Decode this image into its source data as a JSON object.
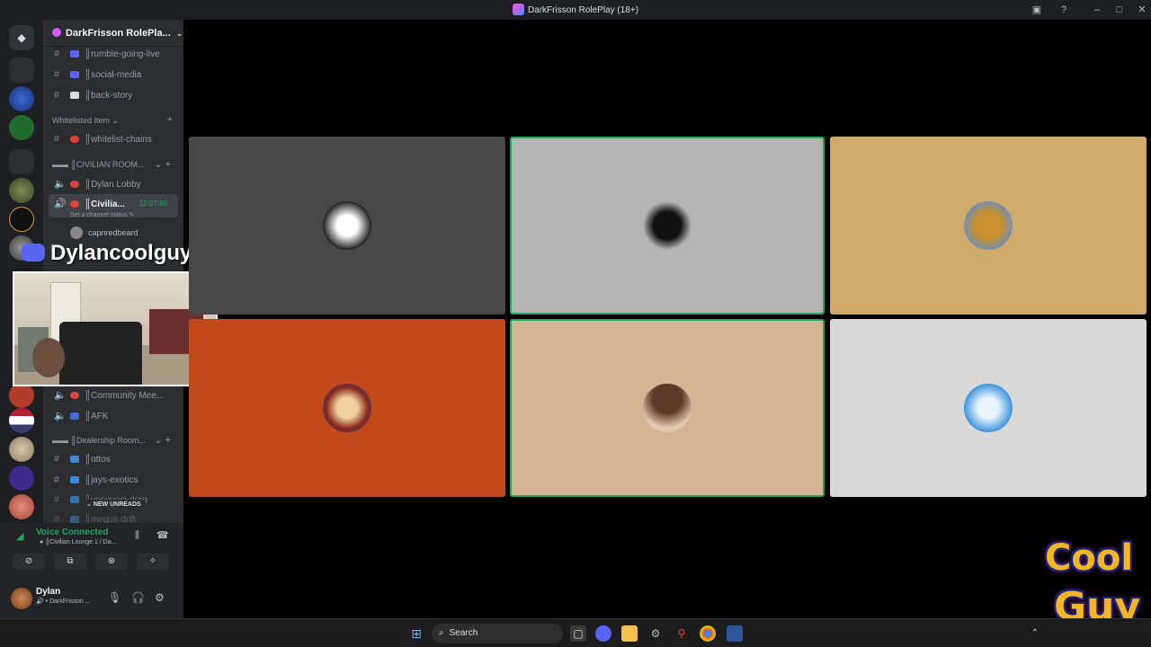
{
  "window": {
    "title": "DarkFrisson RolePlay (18+)",
    "icons": [
      "inbox-icon",
      "help-icon",
      "minimize-icon",
      "maximize-icon",
      "close-icon"
    ]
  },
  "guild": {
    "name": "DarkFrisson RolePla...",
    "channels_top": [
      {
        "label": "║rumble-going-live"
      },
      {
        "label": "║social-media"
      },
      {
        "label": "║back-story"
      }
    ],
    "category_whitelist": "Whitelisted Item",
    "whitelist_channel": "║whitelist-chains",
    "category_civilian": "║CIVILIAN ROOM...",
    "voice_dylan_lobby": "║Dylan Lobby",
    "voice_active": "║Civilia...",
    "voice_active_timer": "12:07:86",
    "voice_status_hint": "Set a channel status",
    "voice_member": "capnredbeard",
    "voice_community": "║Community Mee...",
    "voice_afk": "║AFK",
    "category_dealership": "║Dealership Room...",
    "dealer_channels": [
      {
        "label": "║ottos"
      },
      {
        "label": "║jays-exotics"
      },
      {
        "label": "║yoooyosi-drag"
      },
      {
        "label": "║megus-drift"
      }
    ],
    "new_unreads": "NEW UNREADS"
  },
  "voice_panel": {
    "status": "Voice Connected",
    "channel": "║Civilian Lounge 1 / Da..."
  },
  "user_panel": {
    "name": "Dylan",
    "sub": "DarkFrisson ..."
  },
  "overlay": {
    "streamer_name": "Dylancoolguy"
  },
  "tiles": [
    {
      "bg": "#474747",
      "avatar": "skull-avatar",
      "speaking": false
    },
    {
      "bg": "#b4b4b4",
      "avatar": "dark-figure-avatar",
      "speaking": true
    },
    {
      "bg": "#d0aa6a",
      "avatar": "cartoon-avatar",
      "speaking": false
    },
    {
      "bg": "#c2491a",
      "avatar": "cap-character-avatar",
      "speaking": false
    },
    {
      "bg": "#d3b593",
      "avatar": "face-closeup-avatar",
      "speaking": true
    },
    {
      "bg": "#d9d9d9",
      "avatar": "blue-character-avatar",
      "speaking": false
    }
  ],
  "taskbar": {
    "search": "Search"
  },
  "logo": {
    "line1": "Cool",
    "line2": "Guy"
  },
  "colors": {
    "accent_green": "#23a55a",
    "discord_blurple": "#5865f2"
  }
}
